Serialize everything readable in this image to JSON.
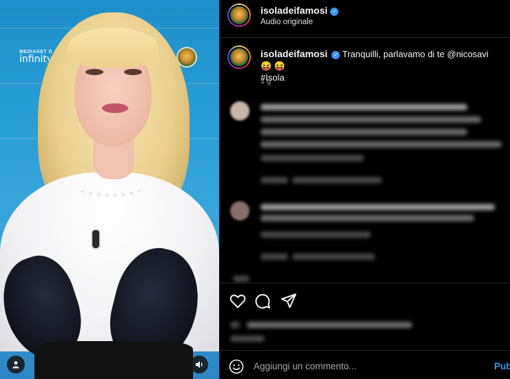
{
  "header": {
    "username": "isoladeifamosi",
    "verified": true,
    "audio_label": "Audio originale",
    "avatar_icon": "profile-avatar-icon"
  },
  "media": {
    "channel_logo_top": "MEDIASET D",
    "channel_logo_bottom": "infinity",
    "watermark_icon": "isola-logo-icon",
    "user_tag_icon": "user-icon",
    "audio_toggle_icon": "speaker-icon"
  },
  "caption": {
    "username": "isoladeifamosi",
    "text": "Tranquilli, parlavamo di te @nicosavi 😝 😝",
    "hashtag": "#Isola",
    "time_ago": "1 g"
  },
  "actions": {
    "icons": [
      "heart-icon",
      "comment-icon",
      "share-icon"
    ]
  },
  "add_comment": {
    "placeholder": "Aggiungi un commento...",
    "publish_label": "Pubblica",
    "emoji_icon": "emoji-icon"
  },
  "colors": {
    "background": "#000000",
    "link_blue": "#3897f0",
    "verified_blue": "#3897f0",
    "divider": "#262626",
    "secondary_text": "#a8a8a8"
  }
}
